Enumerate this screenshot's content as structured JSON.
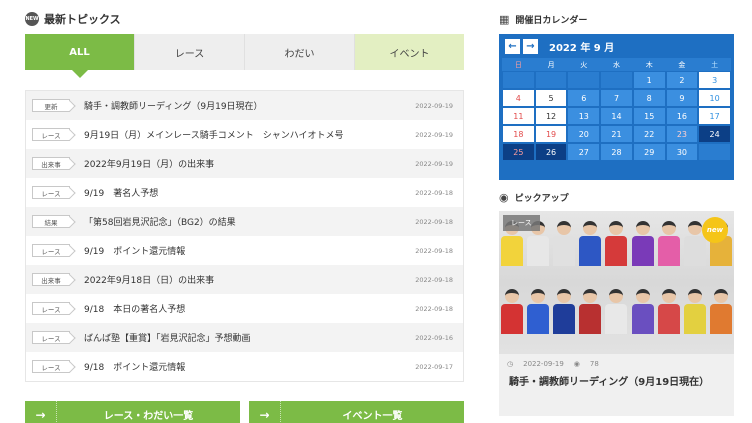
{
  "topics": {
    "title": "最新トピックス",
    "new_icon": "NEW",
    "tabs": [
      "ALL",
      "レース",
      "わだい",
      "イベント"
    ],
    "items": [
      {
        "badge": "更新",
        "title": "騎手・調教師リーディング（9月19日現在）",
        "date": "2022-09-19"
      },
      {
        "badge": "レース",
        "title": "9月19日（月）メインレース騎手コメント　シャンハイオトメ号",
        "date": "2022-09-19"
      },
      {
        "badge": "出来事",
        "title": "2022年9月19日（月）の出来事",
        "date": "2022-09-19"
      },
      {
        "badge": "レース",
        "title": "9/19　著名人予想",
        "date": "2022-09-18"
      },
      {
        "badge": "結果",
        "title": "「第58回岩見沢記念」（BG2）の結果",
        "date": "2022-09-18"
      },
      {
        "badge": "レース",
        "title": "9/19　ポイント還元情報",
        "date": "2022-09-18"
      },
      {
        "badge": "出来事",
        "title": "2022年9月18日（日）の出来事",
        "date": "2022-09-18"
      },
      {
        "badge": "レース",
        "title": "9/18　本日の著名人予想",
        "date": "2022-09-18"
      },
      {
        "badge": "レース",
        "title": "ばんば塾【重賞】「岩見沢記念」予想動画",
        "date": "2022-09-16"
      },
      {
        "badge": "レース",
        "title": "9/18　ポイント還元情報",
        "date": "2022-09-17"
      }
    ],
    "buttons": [
      "レース・わだい一覧",
      "イベント一覧"
    ]
  },
  "calendar": {
    "title": "開催日カレンダー",
    "month_label": "2022 年 9 月",
    "weekdays": [
      "日",
      "月",
      "火",
      "水",
      "木",
      "金",
      "土"
    ],
    "days": [
      [
        "",
        "",
        "",
        "",
        "1",
        "2",
        "3"
      ],
      [
        "4",
        "5",
        "6",
        "7",
        "8",
        "9",
        "10"
      ],
      [
        "11",
        "12",
        "13",
        "14",
        "15",
        "16",
        "17"
      ],
      [
        "18",
        "19",
        "20",
        "21",
        "22",
        "23",
        "24"
      ],
      [
        "25",
        "26",
        "27",
        "28",
        "29",
        "30",
        ""
      ]
    ],
    "colors": {
      "accent": "#1e6fc2",
      "green": "#7cbb46"
    }
  },
  "pickup": {
    "title": "ピックアップ",
    "tag": "レース",
    "new_label": "new",
    "date": "2022-09-19",
    "views": "78",
    "caption": "騎手・調教師リーディング（9月19日現在）"
  }
}
